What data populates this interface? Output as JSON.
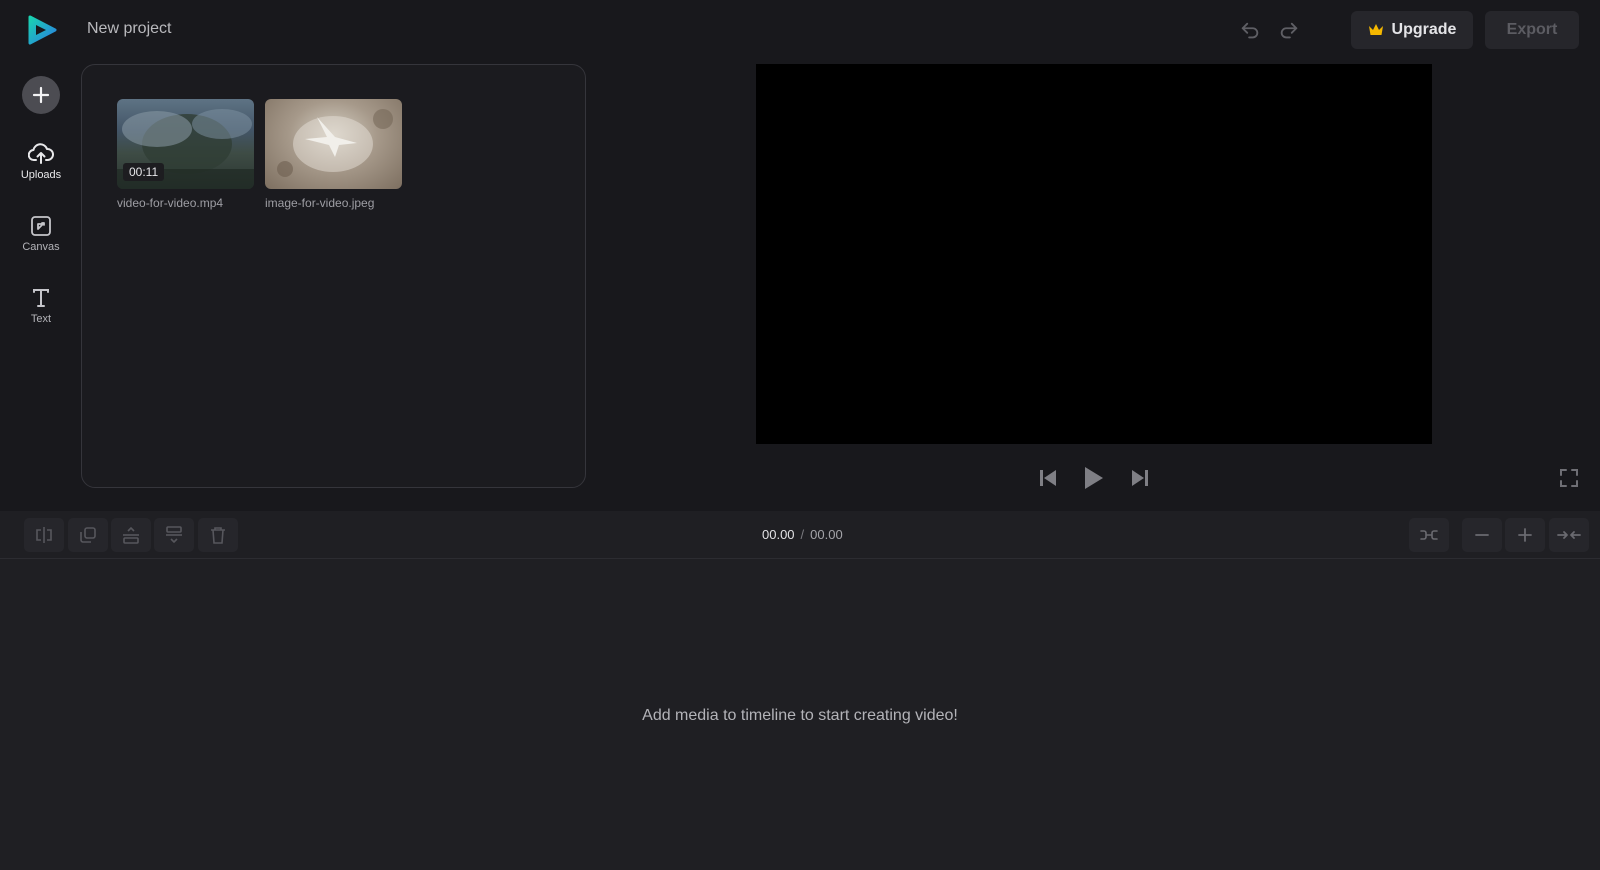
{
  "header": {
    "project_title": "New project",
    "upgrade_label": "Upgrade",
    "export_label": "Export"
  },
  "sidebar": {
    "items": [
      {
        "label": "Uploads",
        "icon": "upload-cloud-icon"
      },
      {
        "label": "Canvas",
        "icon": "canvas-icon"
      },
      {
        "label": "Text",
        "icon": "text-icon"
      }
    ]
  },
  "media": {
    "items": [
      {
        "name": "video-for-video.mp4",
        "duration": "00:11",
        "type": "video"
      },
      {
        "name": "image-for-video.jpeg",
        "type": "image"
      }
    ]
  },
  "playback": {
    "current_time": "00.00",
    "separator": "/",
    "total_time": "00.00"
  },
  "timeline": {
    "empty_message": "Add media to timeline to start creating video!"
  },
  "colors": {
    "background": "#18181c",
    "panel": "#1f1f23",
    "button": "#26262b",
    "upgrade_crown": "#f5b800",
    "logo_gradient_start": "#1dd1a1",
    "logo_gradient_end": "#2e86de"
  }
}
